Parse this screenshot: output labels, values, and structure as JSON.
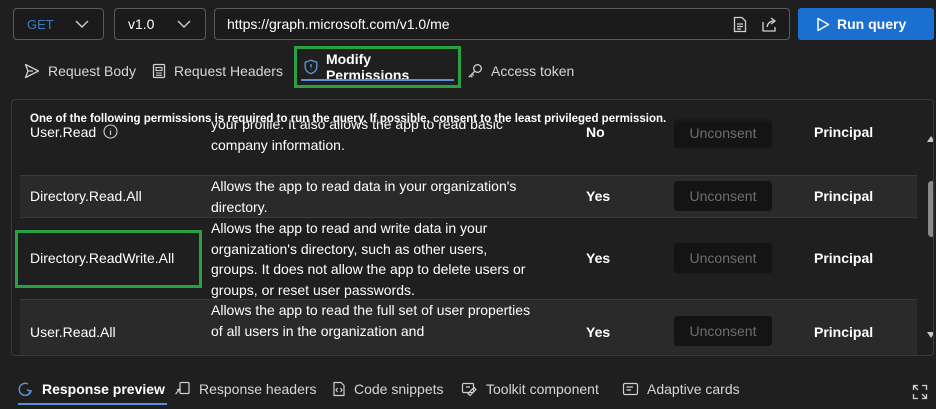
{
  "request": {
    "method": "GET",
    "version": "v1.0",
    "url": "https://graph.microsoft.com/v1.0/me",
    "run_label": "Run query"
  },
  "request_tabs": [
    {
      "label": "Request Body"
    },
    {
      "label": "Request Headers"
    },
    {
      "label": "Modify Permissions"
    },
    {
      "label": "Access token"
    }
  ],
  "permissions": {
    "notice": "One of the following permissions is required to run the query. If possible, consent to the least privileged permission.",
    "rows": [
      {
        "name": "User.Read",
        "desc": "Allows users to sign-in to the app, and allows the app to read the profile of signed-in users. It also allows the app to read basic company information.",
        "desc_visible": "your profile. It also allows the app to read basic company information.",
        "admin": "No",
        "action": "Unconsent",
        "type": "Principal"
      },
      {
        "name": "Directory.Read.All",
        "desc": "Allows the app to read data in your organization's directory.",
        "admin": "Yes",
        "action": "Unconsent",
        "type": "Principal"
      },
      {
        "name": "Directory.ReadWrite.All",
        "desc": "Allows the app to read and write data in your organization's directory, such as other users, groups. It does not allow the app to delete users or groups, or reset user passwords.",
        "admin": "Yes",
        "action": "Unconsent",
        "type": "Principal"
      },
      {
        "name": "User.Read.All",
        "desc": "Allows the app to read the full set of user properties of all users in the organization and",
        "admin": "Yes",
        "action": "Unconsent",
        "type": "Principal"
      }
    ]
  },
  "response_tabs": [
    {
      "label": "Response preview"
    },
    {
      "label": "Response headers"
    },
    {
      "label": "Code snippets"
    },
    {
      "label": "Toolkit component"
    },
    {
      "label": "Adaptive cards"
    }
  ],
  "colors": {
    "accent": "#1a6fd0",
    "highlight": "#2aa044",
    "background": "#1f1f1f"
  },
  "icons": [
    "chevron-down-icon",
    "document-icon",
    "share-icon",
    "play-icon",
    "send-icon",
    "doc-icon",
    "shield-icon",
    "key-icon",
    "info-icon",
    "response-icon",
    "code-icon",
    "toolkit-icon",
    "cards-icon",
    "expand-icon"
  ]
}
